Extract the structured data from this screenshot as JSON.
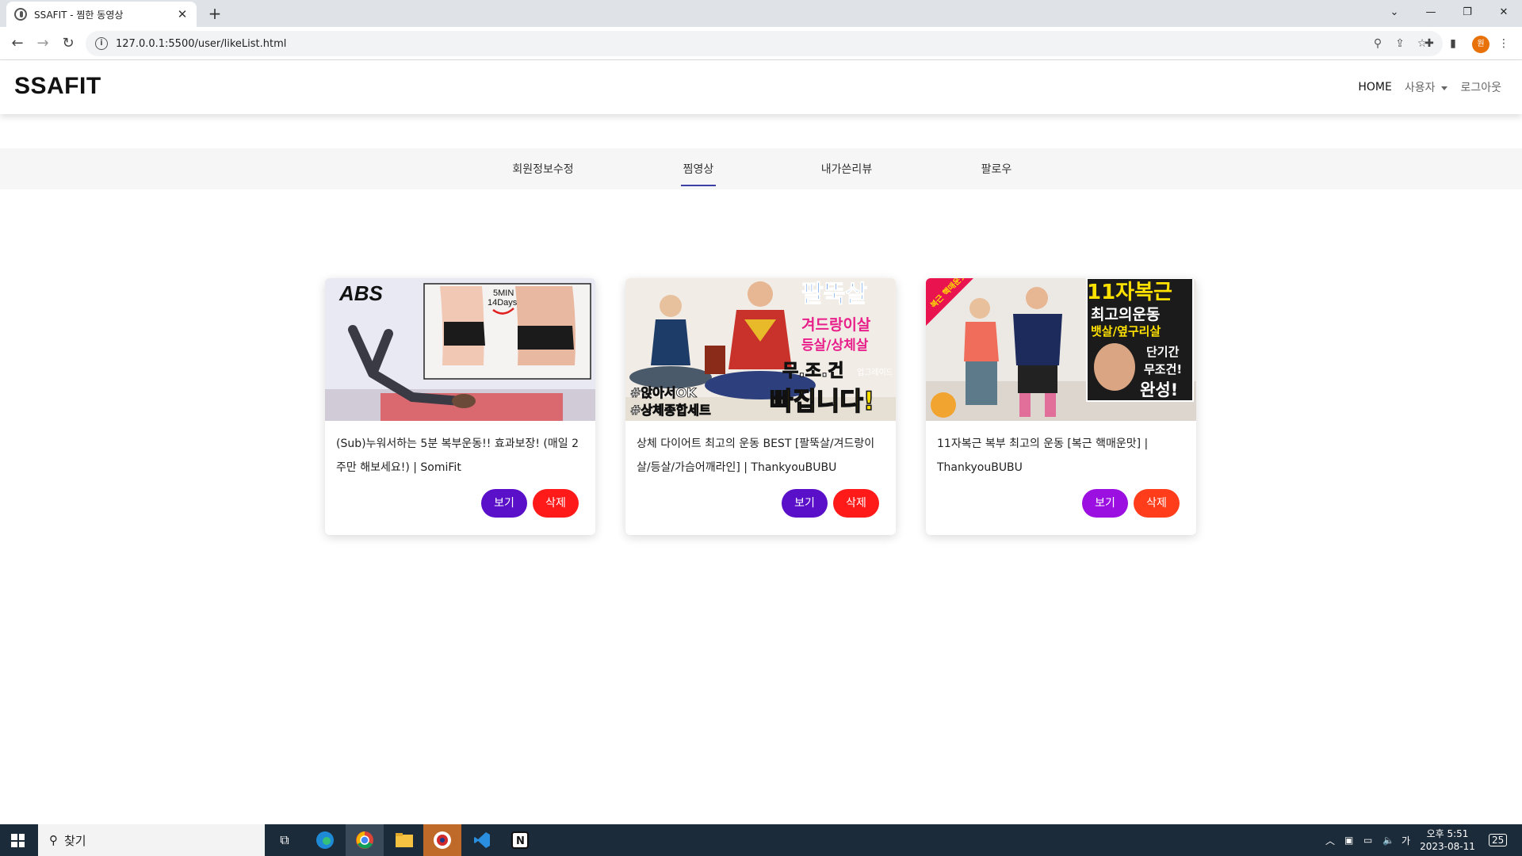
{
  "browser": {
    "tab_title": "SSAFIT - 찜한 동영상",
    "url": "127.0.0.1:5500/user/likeList.html",
    "profile_initial": "원"
  },
  "header": {
    "logo": "SSAFIT",
    "nav": {
      "home": "HOME",
      "user": "사용자",
      "logout": "로그아웃"
    }
  },
  "subnav": {
    "items": [
      {
        "label": "회원정보수정",
        "active": false
      },
      {
        "label": "찜영상",
        "active": true
      },
      {
        "label": "내가쓴리뷰",
        "active": false
      },
      {
        "label": "팔로우",
        "active": false
      }
    ]
  },
  "cards": [
    {
      "title": "(Sub)누워서하는 5분 복부운동!! 효과보장! (매일 2주만 해보세요!) | SomiFit",
      "view_label": "보기",
      "delete_label": "삭제",
      "thumb_text": {
        "main": "ABS",
        "badge_line1": "5MIN",
        "badge_line2": "14Days"
      }
    },
    {
      "title": "상체 다이어트 최고의 운동 BEST [팔뚝살/겨드랑이살/등살/가슴어깨라인] | ThankyouBUBU",
      "view_label": "보기",
      "delete_label": "삭제",
      "thumb_text": {
        "l1": "팔뚝살",
        "l2": "겨드랑이살",
        "l3": "등살/상체살",
        "l4": "무.조.건",
        "tag": "업그레이드",
        "l5": "빠집니다!",
        "b1": "#앉아서OK",
        "b2": "#상체종합세트"
      }
    },
    {
      "title": "11자복근 복부 최고의 운동 [복근 핵매운맛] | ThankyouBUBU",
      "view_label": "보기",
      "delete_label": "삭제",
      "thumb_text": {
        "corner": "복근 핵매운맛",
        "l1": "11자복근",
        "l2": "최고의운동",
        "l3": "뱃살/옆구리살",
        "l4": "단기간",
        "l5": "무조건!",
        "l6": "완성!"
      }
    }
  ],
  "taskbar": {
    "search_placeholder": "찾기",
    "ime": "가",
    "time": "오후 5:51",
    "date": "2023-08-11",
    "notifications": "25"
  },
  "colors": {
    "view_button": [
      "#5a0fc8",
      "#5a0fc8",
      "#9b10e0"
    ],
    "delete_button": [
      "#ff1a1a",
      "#ff1a1a",
      "#ff3d1a"
    ],
    "active_tab_underline": "#3c3fa6",
    "taskbar": "#1c2b3a"
  }
}
